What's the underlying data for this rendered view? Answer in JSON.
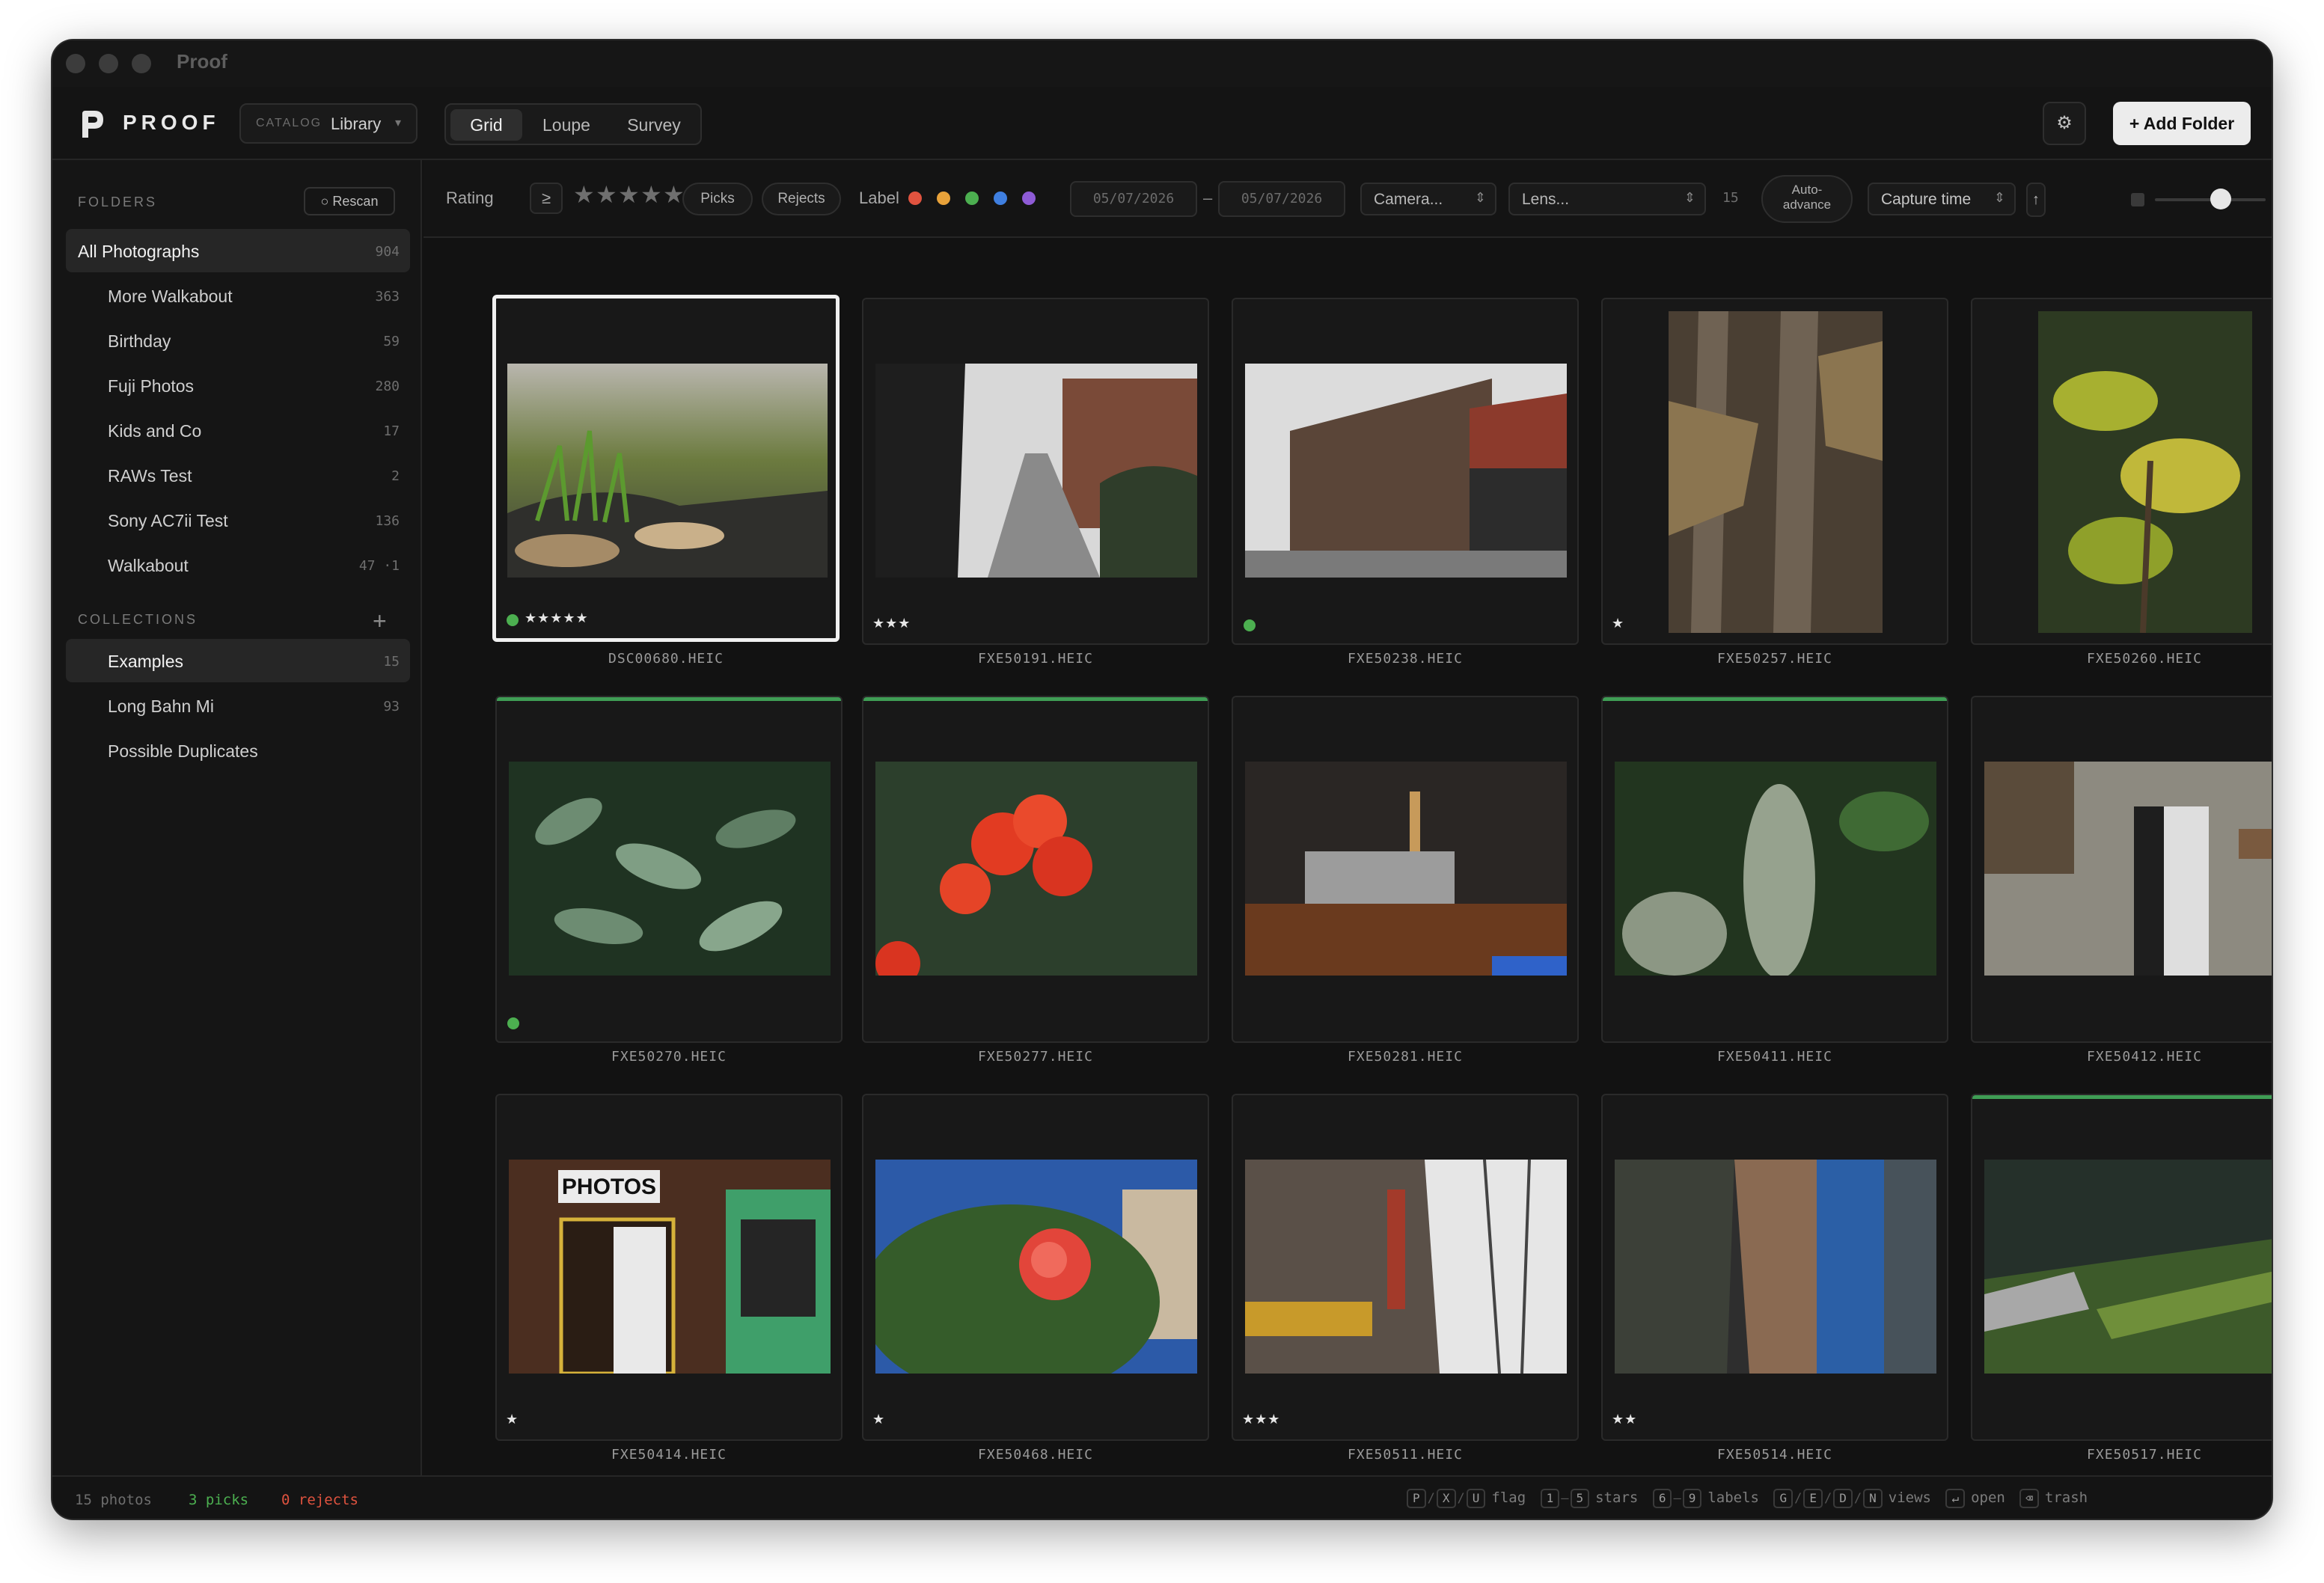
{
  "window": {
    "title": "Proof"
  },
  "header": {
    "brand": "PROOF",
    "catalog_label": "CATALOG",
    "catalog_value": "Library",
    "view_tabs": [
      "Grid",
      "Loupe",
      "Survey"
    ],
    "active_tab": "Grid",
    "settings_icon": "gear-icon",
    "add_folder_label": "+ Add Folder"
  },
  "sidebar": {
    "folders_title": "FOLDERS",
    "rescan_label": "○ Rescan",
    "folders": [
      {
        "name": "All Photographs",
        "count": "904",
        "selected": true
      },
      {
        "name": "More Walkabout",
        "count": "363"
      },
      {
        "name": "Birthday",
        "count": "59"
      },
      {
        "name": "Fuji Photos",
        "count": "280"
      },
      {
        "name": "Kids and Co",
        "count": "17"
      },
      {
        "name": "RAWs Test",
        "count": "2"
      },
      {
        "name": "Sony AC7ii Test",
        "count": "136"
      },
      {
        "name": "Walkabout",
        "count": "47 ·1"
      }
    ],
    "collections_title": "COLLECTIONS",
    "collections_add": "+",
    "collections": [
      {
        "name": "Examples",
        "count": "15",
        "selected": true
      },
      {
        "name": "Long Bahn Mi",
        "count": "93"
      },
      {
        "name": "Possible Duplicates",
        "count": ""
      }
    ]
  },
  "filters": {
    "rating_label": "Rating",
    "rating_operator": "≥",
    "stars": "★★★★★",
    "picks_label": "Picks",
    "rejects_label": "Rejects",
    "label_label": "Label",
    "label_colors": [
      "#e0533f",
      "#e8a23a",
      "#4caf50",
      "#3f7fe0",
      "#8e5bd6"
    ],
    "date_from": "05/07/2026",
    "date_sep": "–",
    "date_to": "05/07/2026",
    "camera_placeholder": "Camera...",
    "lens_placeholder": "Lens...",
    "result_count": "15",
    "auto_advance": [
      "Auto-",
      "advance"
    ],
    "sort_label": "Capture time",
    "sort_direction": "↑"
  },
  "photos": [
    {
      "name": "DSC00680.HEIC",
      "stars": "★★★★★",
      "dot": true,
      "selected": true,
      "shape": "landscape"
    },
    {
      "name": "FXE50191.HEIC",
      "stars": "★★★",
      "shape": "landscape"
    },
    {
      "name": "FXE50238.HEIC",
      "dot": true,
      "shape": "landscape"
    },
    {
      "name": "FXE50257.HEIC",
      "stars": "★",
      "shape": "portrait"
    },
    {
      "name": "FXE50260.HEIC",
      "shape": "portrait"
    },
    {
      "name": "FXE50270.HEIC",
      "dot": true,
      "picked": true,
      "shape": "landscape"
    },
    {
      "name": "FXE50277.HEIC",
      "picked": true,
      "shape": "landscape"
    },
    {
      "name": "FXE50281.HEIC",
      "shape": "landscape"
    },
    {
      "name": "FXE50411.HEIC",
      "picked": true,
      "shape": "landscape"
    },
    {
      "name": "FXE50412.HEIC",
      "shape": "landscape"
    },
    {
      "name": "FXE50414.HEIC",
      "stars": "★",
      "shape": "landscape",
      "sign": "PHOTOS"
    },
    {
      "name": "FXE50468.HEIC",
      "stars": "★",
      "shape": "landscape"
    },
    {
      "name": "FXE50511.HEIC",
      "stars": "★★★",
      "shape": "landscape"
    },
    {
      "name": "FXE50514.HEIC",
      "stars": "★★",
      "shape": "landscape"
    },
    {
      "name": "FXE50517.HEIC",
      "picked": true,
      "shape": "landscape"
    }
  ],
  "status": {
    "photos": "15 photos",
    "picks": "3 picks",
    "rejects": "0 rejects",
    "picks_color": "#4caf50",
    "rejects_color": "#e0533f",
    "shortcuts": [
      {
        "keys": [
          "P",
          "X",
          "U"
        ],
        "joiner": "/",
        "label": "flag"
      },
      {
        "keys": [
          "1",
          "5"
        ],
        "joiner": "–",
        "label": "stars"
      },
      {
        "keys": [
          "6",
          "9"
        ],
        "joiner": "–",
        "label": "labels"
      },
      {
        "keys": [
          "G",
          "E",
          "D",
          "N"
        ],
        "joiner": "/",
        "label": "views"
      },
      {
        "keys": [
          "↵"
        ],
        "joiner": "",
        "label": "open"
      },
      {
        "keys": [
          "⌫"
        ],
        "joiner": "",
        "label": "trash"
      }
    ]
  }
}
